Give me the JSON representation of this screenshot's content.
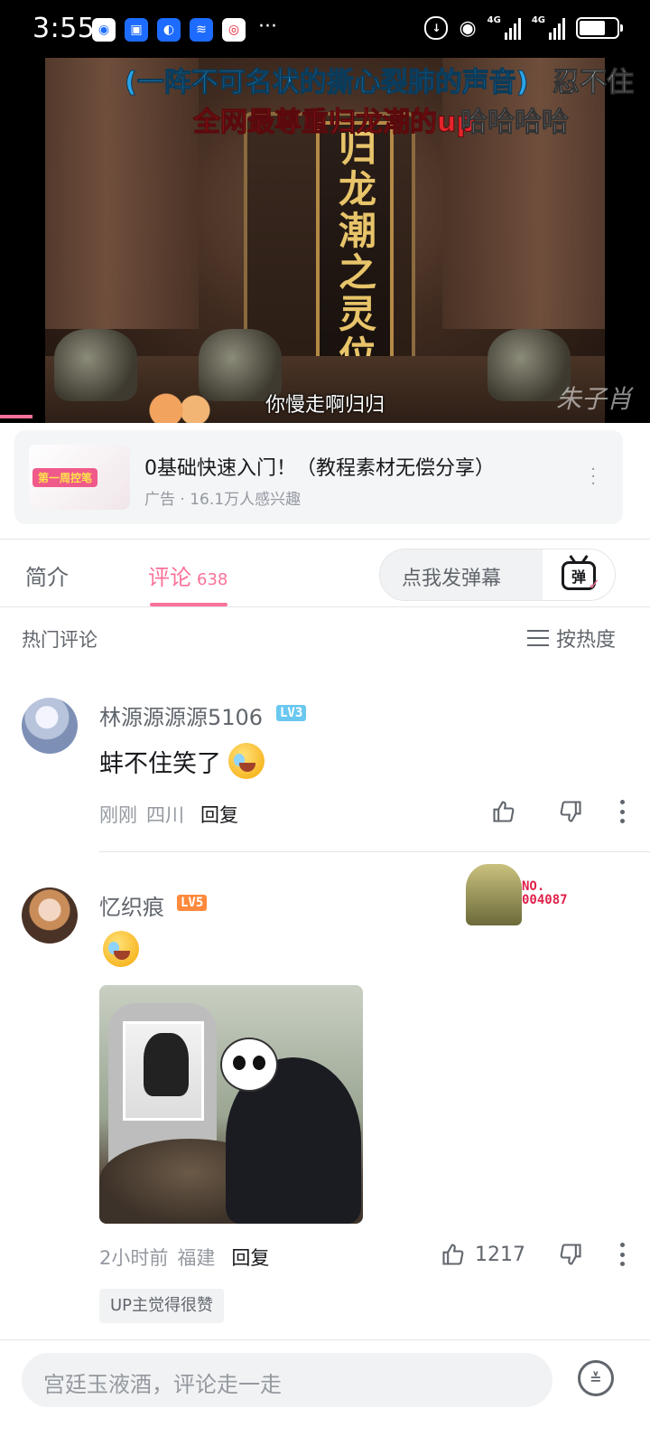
{
  "status_bar": {
    "time": "3:55",
    "app_icons": [
      "baidu-netdisk-icon",
      "app-icon",
      "browser-icon",
      "wifi-icon",
      "weibo-icon"
    ],
    "network_1": "4G",
    "network_2": "4G"
  },
  "video": {
    "danmaku": [
      {
        "text": "(一阵不可名状的撕心裂肺的声音)",
        "color": "#2aa3e8"
      },
      {
        "text": "忍不住",
        "color": "#ffffff"
      },
      {
        "text": "全网最尊重归龙潮的up",
        "color": "#e3242b"
      },
      {
        "text": "哈哈哈哈",
        "color": "#ffffff"
      }
    ],
    "tablet_text": "归龙潮之灵位",
    "subtitle": "你慢走啊归归",
    "watermark": "朱子肖"
  },
  "ad": {
    "thumb_badge": "第一周控笔",
    "title": "0基础快速入门！（教程素材无偿分享）",
    "meta": "广告 · 16.1万人感兴趣"
  },
  "tabs": {
    "intro": "简介",
    "comments": "评论",
    "comments_count": "638",
    "danmaku_placeholder": "点我发弹幕",
    "danmaku_button": "弹"
  },
  "comments_header": {
    "title": "热门评论",
    "sort_label": "按热度"
  },
  "comments": [
    {
      "username": "林源源源源5106",
      "level": "LV3",
      "text": "蚌不住笑了",
      "time": "刚刚",
      "location": "四川",
      "reply": "回复",
      "likes": ""
    },
    {
      "username": "忆织痕",
      "level": "LV5",
      "text": "",
      "fan_badge": "NO.\n004087",
      "time": "2小时前",
      "location": "福建",
      "reply": "回复",
      "likes": "1217",
      "tag": "UP主觉得很赞"
    }
  ],
  "bottom_bar": {
    "placeholder": "宫廷玉液酒，评论走一走"
  },
  "colors": {
    "accent": "#fb7299",
    "text_primary": "#18191c",
    "text_secondary": "#61666d",
    "text_tertiary": "#9499a0"
  }
}
